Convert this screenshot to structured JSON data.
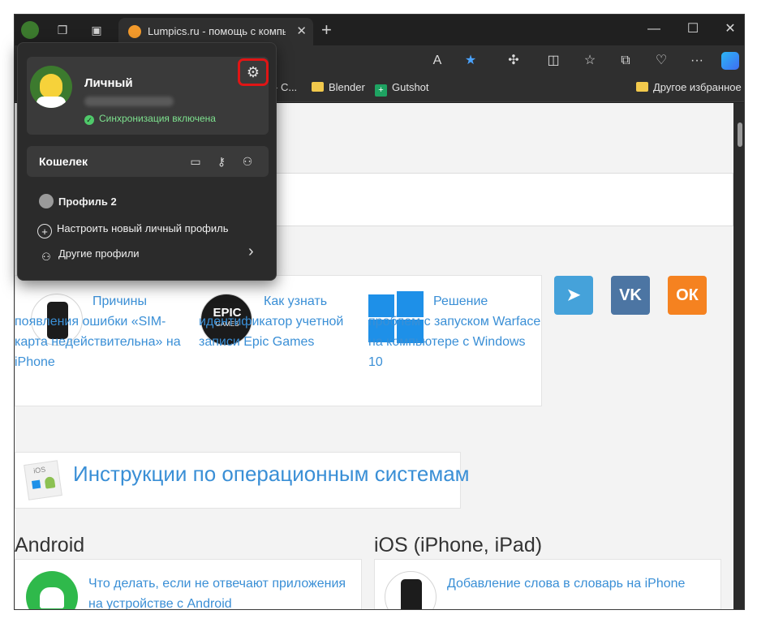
{
  "browser": {
    "tab_title": "Lumpics.ru - помощь с компьют",
    "tab_close": "✕",
    "new_tab": "+",
    "window_controls": {
      "minimize": "—",
      "maximize": "☐",
      "close": "✕"
    },
    "toolbar_icons": [
      "read-aloud-icon",
      "favorite-star-icon",
      "extensions-icon",
      "split-screen-icon",
      "favorites-icon",
      "collections-icon",
      "health-icon",
      "more-icon",
      "copilot-icon"
    ],
    "more_label": "···",
    "read_aloud": "Ā",
    "favorites_bar": {
      "partial_item": "- C...",
      "items": [
        "Blender",
        "Gutshot"
      ],
      "other_favorites": "Другое избранное"
    },
    "accent_color": "#1a73e8"
  },
  "profile_flyout": {
    "name": "Личный",
    "sync_status": "Синхронизация включена",
    "wallet_label": "Кошелек",
    "profile2": "Профиль 2",
    "setup_new": "Настроить новый личный профиль",
    "other_profiles": "Другие профили",
    "chevron": "›",
    "gear": "⚙",
    "highlight_color": "#e01515"
  },
  "page": {
    "articles": [
      {
        "text": "Причины появления ошибки «SIM-карта недействительна» на iPhone",
        "icon": "iphone-icon"
      },
      {
        "text": "Как узнать идентификатор учетной записи Epic Games",
        "icon": "epic-games-icon"
      },
      {
        "text": "Решение проблем с запуском Warface на компьютере с Windows 10",
        "icon": "windows-icon"
      }
    ],
    "epic_logo": "EPIC",
    "epic_sub": "GAMES",
    "social": [
      {
        "name": "telegram",
        "glyph": "➤",
        "color": "#45a2da"
      },
      {
        "name": "vk",
        "glyph": "VK",
        "color": "#4c75a3"
      },
      {
        "name": "ok",
        "glyph": "ОК",
        "color": "#f58220"
      }
    ],
    "section_title": "Инструкции по операционным системам",
    "ios_tag": "iOS",
    "columns": [
      {
        "heading": "Android",
        "article": "Что делать, если не отвечают приложения на устройстве с Android"
      },
      {
        "heading": "iOS (iPhone, iPad)",
        "article": "Добавление слова в словарь на iPhone"
      }
    ]
  }
}
